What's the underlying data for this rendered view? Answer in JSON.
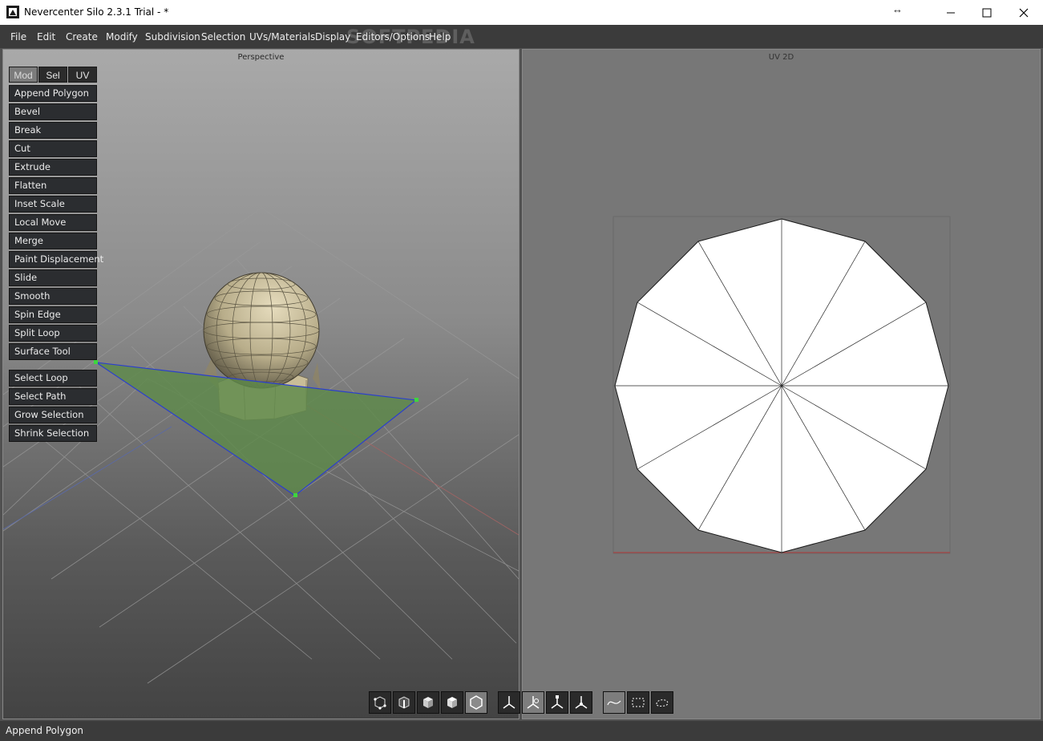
{
  "window": {
    "title": "Nevercenter Silo 2.3.1 Trial - *",
    "resize_glyph": "↔",
    "controls": [
      "minimize-icon",
      "maximize-icon",
      "close-icon"
    ]
  },
  "menu": {
    "items": [
      "File",
      "Edit",
      "Create",
      "Modify",
      "Subdivision",
      "Selection",
      "UVs/Materials",
      "Display",
      "Editors/Options",
      "Help"
    ],
    "watermark": "SOFTPEDIA"
  },
  "viewports": {
    "perspective": {
      "title": "Perspective"
    },
    "uv": {
      "title": "UV 2D"
    }
  },
  "palette": {
    "tabs": [
      "Mod",
      "Sel",
      "UV"
    ],
    "active_tab": "Mod",
    "modify_tools": [
      "Append Polygon",
      "Bevel",
      "Break",
      "Cut",
      "Extrude",
      "Flatten",
      "Inset Scale",
      "Local Move",
      "Merge",
      "Paint Displacement",
      "Slide",
      "Smooth",
      "Spin Edge",
      "Split Loop",
      "Surface Tool"
    ],
    "selection_tools": [
      "Select Loop",
      "Select Path",
      "Grow Selection",
      "Shrink Selection"
    ]
  },
  "toolbar": {
    "buttons": [
      {
        "name": "vertex-mode-icon",
        "active": false
      },
      {
        "name": "edge-mode-icon",
        "active": false
      },
      {
        "name": "face-mode-icon",
        "active": false
      },
      {
        "name": "object-mode-icon",
        "active": false
      },
      {
        "name": "auto-mode-icon",
        "active": true
      },
      {
        "name": "move-manipulator-icon",
        "active": false
      },
      {
        "name": "rotate-manipulator-icon",
        "active": true
      },
      {
        "name": "scale-manipulator-icon",
        "active": false
      },
      {
        "name": "universal-manipulator-icon",
        "active": false
      },
      {
        "name": "paint-select-icon",
        "active": true
      },
      {
        "name": "rect-select-icon",
        "active": false
      },
      {
        "name": "lasso-select-icon",
        "active": false
      }
    ]
  },
  "status": {
    "text": "Append Polygon"
  },
  "colors": {
    "ui_dark": "#2b2d30",
    "menu_bg": "#3b3b3b",
    "uv_bg": "#777777",
    "polygon_fill": "#5e8a4a",
    "polygon_edge": "#2a3ecf",
    "mesh_color": "#c9bd98"
  }
}
